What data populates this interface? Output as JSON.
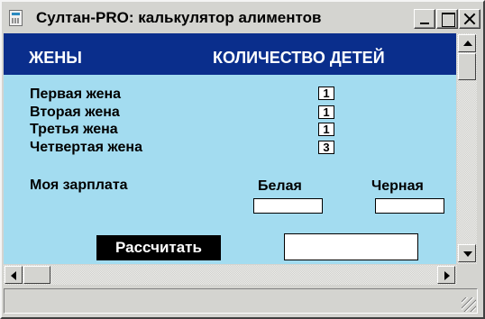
{
  "window": {
    "title": "Султан-PRO: калькулятор алиментов"
  },
  "header": {
    "wives": "ЖЕНЫ",
    "children_count": "КОЛИЧЕСТВО ДЕТЕЙ"
  },
  "wives": [
    {
      "label": "Первая жена",
      "children": "1"
    },
    {
      "label": "Вторая жена",
      "children": "1"
    },
    {
      "label": "Третья жена",
      "children": "1"
    },
    {
      "label": "Четвертая жена",
      "children": "3"
    }
  ],
  "salary": {
    "label": "Моя зарплата",
    "white_label": "Белая",
    "black_label": "Черная",
    "white_value": "",
    "black_value": ""
  },
  "actions": {
    "calculate_label": "Рассчитать",
    "result_value": ""
  },
  "colors": {
    "background": "#a3dcf0",
    "header_band": "#0a2e8c",
    "button": "#000000"
  }
}
